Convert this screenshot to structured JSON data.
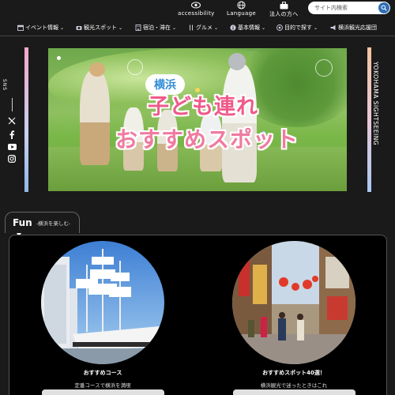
{
  "utility": {
    "accessibility": "accessibility",
    "language": "Language",
    "corporate": "法人の方へ"
  },
  "search": {
    "placeholder": "サイト内検索"
  },
  "nav": {
    "items": [
      {
        "label": "イベント情報",
        "icon": "calendar-icon"
      },
      {
        "label": "観光スポット",
        "icon": "camera-icon"
      },
      {
        "label": "宿泊・滞在",
        "icon": "hotel-icon"
      },
      {
        "label": "グルメ",
        "icon": "fork-knife-icon"
      },
      {
        "label": "基本情報",
        "icon": "info-icon"
      },
      {
        "label": "目的で探す",
        "icon": "target-icon"
      },
      {
        "label": "横浜観光応援団",
        "icon": "megaphone-icon"
      }
    ]
  },
  "side": {
    "sns_label": "SNS",
    "vertical_title": "YOKOHAMA SIGHTSEEING",
    "sns_icons": [
      "x-icon",
      "facebook-icon",
      "youtube-icon",
      "instagram-icon"
    ]
  },
  "hero": {
    "badge": "横浜",
    "line1": "子ども連れ",
    "line2": "おすすめスポット"
  },
  "fun": {
    "title": "Fun",
    "subtitle": "-横浜を楽しむ-"
  },
  "cards": [
    {
      "title": "おすすめコース",
      "desc": "定番コースで横浜を満喫"
    },
    {
      "title": "おすすめスポット40選！",
      "desc": "横浜観光で迷ったときはこれ"
    }
  ],
  "colors": {
    "background": "#1a1a1a",
    "search_button": "#2f6fb5",
    "hero_pink": "#ef5a8a",
    "hero_blue": "#2f8bd6"
  }
}
